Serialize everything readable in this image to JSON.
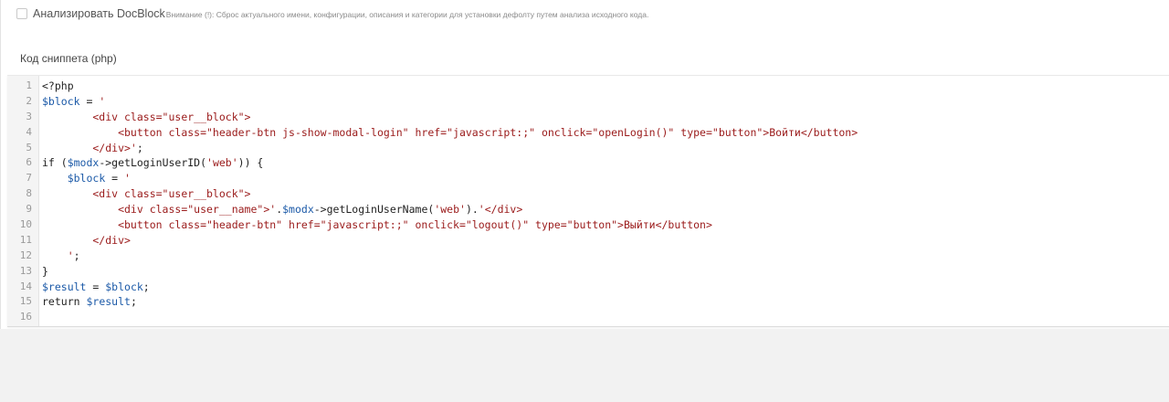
{
  "docblock": {
    "label": "Анализировать DocBlock",
    "note": "Внимание (!): Сброс актуального имени, конфигурации, описания и категории для установки дефолту путем анализа исходного кода."
  },
  "editor": {
    "label": "Код сниппета (php)",
    "lines": [
      {
        "n": "1",
        "parts": [
          [
            "op",
            "<?php"
          ]
        ]
      },
      {
        "n": "2",
        "parts": [
          [
            "var",
            "$block"
          ],
          [
            "op",
            " = "
          ],
          [
            "str",
            "'"
          ]
        ]
      },
      {
        "n": "3",
        "parts": [
          [
            "str",
            "        <div class=\"user__block\">"
          ]
        ]
      },
      {
        "n": "4",
        "parts": [
          [
            "str",
            "            <button class=\"header-btn js-show-modal-login\" href=\"javascript:;\" onclick=\"openLogin()\" type=\"button\">Войти</button>"
          ]
        ]
      },
      {
        "n": "5",
        "parts": [
          [
            "str",
            "        </div>'"
          ],
          [
            "op",
            ";"
          ]
        ]
      },
      {
        "n": "6",
        "parts": [
          [
            "kw",
            "if ("
          ],
          [
            "var",
            "$modx"
          ],
          [
            "op",
            "->getLoginUserID("
          ],
          [
            "str",
            "'web'"
          ],
          [
            "op",
            ")) {"
          ]
        ]
      },
      {
        "n": "7",
        "parts": [
          [
            "op",
            "    "
          ],
          [
            "var",
            "$block"
          ],
          [
            "op",
            " = "
          ],
          [
            "str",
            "'"
          ]
        ]
      },
      {
        "n": "8",
        "parts": [
          [
            "str",
            "        <div class=\"user__block\">"
          ]
        ]
      },
      {
        "n": "9",
        "parts": [
          [
            "str",
            "            <div class=\"user__name\">'"
          ],
          [
            "op",
            "."
          ],
          [
            "var",
            "$modx"
          ],
          [
            "op",
            "->getLoginUserName("
          ],
          [
            "str",
            "'web'"
          ],
          [
            "op",
            ")."
          ],
          [
            "str",
            "'</div>"
          ]
        ]
      },
      {
        "n": "10",
        "parts": [
          [
            "str",
            "            <button class=\"header-btn\" href=\"javascript:;\" onclick=\"logout()\" type=\"button\">Выйти</button>"
          ]
        ]
      },
      {
        "n": "11",
        "parts": [
          [
            "str",
            "        </div>"
          ]
        ]
      },
      {
        "n": "12",
        "parts": [
          [
            "str",
            "    '"
          ],
          [
            "op",
            ";"
          ]
        ]
      },
      {
        "n": "13",
        "parts": [
          [
            "op",
            "}"
          ]
        ]
      },
      {
        "n": "14",
        "parts": [
          [
            "var",
            "$result"
          ],
          [
            "op",
            " = "
          ],
          [
            "var",
            "$block"
          ],
          [
            "op",
            ";"
          ]
        ]
      },
      {
        "n": "15",
        "parts": [
          [
            "kw",
            "return "
          ],
          [
            "var",
            "$result"
          ],
          [
            "op",
            ";"
          ]
        ]
      },
      {
        "n": "16",
        "parts": [
          [
            "op",
            ""
          ]
        ]
      }
    ]
  }
}
